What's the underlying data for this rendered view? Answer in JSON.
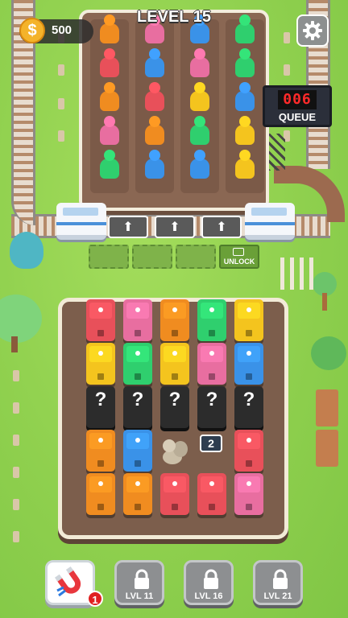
{
  "hud": {
    "coins": "500",
    "coin_symbol": "$",
    "level": "LEVEL 15",
    "settings_icon": "gear-icon"
  },
  "queue": {
    "digits": "006",
    "label": "QUEUE"
  },
  "colors": {
    "orange": "#f08c20",
    "pink": "#e86ea0",
    "blue": "#3a92e8",
    "green": "#2fcf6e",
    "yellow": "#f4c41e",
    "red": "#e8505a",
    "mystery": "#2c2c2c"
  },
  "passenger_lanes": [
    [
      "orange",
      "red",
      "orange",
      "pink",
      "green"
    ],
    [
      "pink",
      "blue",
      "red",
      "orange",
      "blue"
    ],
    [
      "blue",
      "pink",
      "yellow",
      "green",
      "blue"
    ],
    [
      "green",
      "green",
      "blue",
      "yellow",
      "yellow"
    ]
  ],
  "docks": {
    "arrow": "⬆",
    "unlock_label": "UNLOCK"
  },
  "yard": {
    "columns": [
      [
        "red",
        "yellow",
        "mystery",
        "orange",
        "orange"
      ],
      [
        "pink",
        "green",
        "mystery",
        "blue",
        "orange"
      ],
      [
        "orange",
        "yellow",
        "mystery",
        "rock",
        "red"
      ],
      [
        "green",
        "pink",
        "mystery",
        "counter",
        "red"
      ],
      [
        "yellow",
        "blue",
        "mystery",
        "red",
        "pink"
      ]
    ],
    "mystery_mark": "?",
    "counter_value": "2"
  },
  "boosters": {
    "magnet_icon": "magnet-icon",
    "magnet_count": "1",
    "locked": [
      {
        "label": "LVL 11"
      },
      {
        "label": "LVL 16"
      },
      {
        "label": "LVL 21"
      }
    ]
  }
}
